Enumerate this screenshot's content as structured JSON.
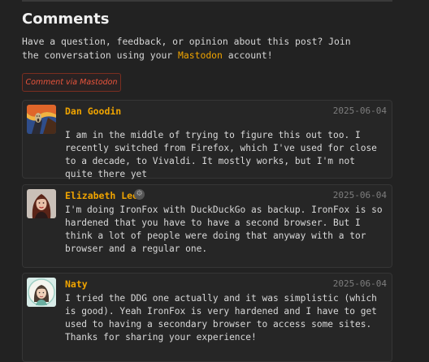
{
  "section": {
    "heading": "Comments",
    "intro_before": "Have a question, feedback, or opinion about this post? Join the conversation using your ",
    "intro_link": "Mastodon",
    "intro_after": " account!",
    "cta_label": "Comment via Mastodon"
  },
  "comments": [
    {
      "author": "Dan Goodin",
      "date": "2025-06-04",
      "text": "I am in the middle of trying to figure this out too. I recently switched from Firefox, which I've used for close to a decade, to Vivaldi. It mostly works, but I'm not quite there yet",
      "avatar": "scream-painting-avatar"
    },
    {
      "author": "Elizabeth Lee",
      "date": "2025-06-04",
      "text": "I'm doing IronFox with DuckDuckGo as backup. IronFox is so hardened that you have to have a second browser. But I think a lot of people were doing that anyway with a tor browser and a regular one.",
      "avatar": "portrait-avatar",
      "badge": "bot-icon"
    },
    {
      "author": "Naty",
      "date": "2025-06-04",
      "text": "I tried the DDG one actually and it was simplistic (which is good). Yeah IronFox is very hardened and I have to get used to having a secondary browser to access some sites. Thanks for sharing your experience!",
      "avatar": "illustrated-avatar"
    }
  ],
  "colors": {
    "background": "#222222",
    "accent": "#f0a400",
    "cta": "#e8543c",
    "muted": "#7d7d7d"
  }
}
